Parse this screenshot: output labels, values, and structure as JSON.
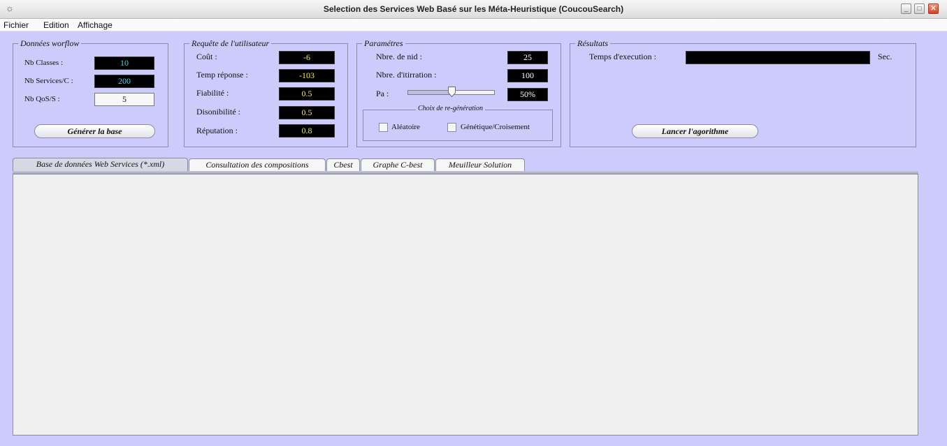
{
  "window": {
    "title": "Selection des Services Web Basé sur les Méta-Heuristique (CoucouSearch)"
  },
  "menu": [
    "Fichier",
    "Edition",
    "Affichage"
  ],
  "workflow": {
    "legend": "Données worflow",
    "nb_classes_label": "Nb Classes :",
    "nb_classes_value": "10",
    "nb_services_label": "Nb Services/C :",
    "nb_services_value": "200",
    "nb_qos_label": "Nb QoS/S :",
    "nb_qos_value": "5",
    "generate_button": "Générer la base"
  },
  "request": {
    "legend": "Requête de l'utilisateur",
    "cout_label": "Coût :",
    "cout_value": "-6",
    "temps_label": "Temp réponse :",
    "temps_value": "-103",
    "fiabilite_label": "Fiabilité :",
    "fiabilite_value": "0.5",
    "disponibilite_label": "Disonibilité :",
    "disponibilite_value": "0.5",
    "reputation_label": "Réputation :",
    "reputation_value": "0.8"
  },
  "params": {
    "legend": "Paramétres",
    "nid_label": "Nbre. de nid :",
    "nid_value": "25",
    "iter_label": "Nbre. d'itirration :",
    "iter_value": "100",
    "pa_label": "Pa :",
    "pa_value": "50%",
    "pa_fraction": 0.5,
    "regen_legend": "Choix de re-génération",
    "aleatoire_label": "Aléatoire",
    "genetique_label": "Génétique/Croisement"
  },
  "results": {
    "legend": "Résultats",
    "exec_label": "Temps d'execution :",
    "exec_value": "",
    "unit": "Sec.",
    "launch_button": "Lancer l'agorithme"
  },
  "tabs": [
    "Base de données Web Services (*.xml)",
    "Consultation des compositions",
    "Cbest",
    "Graphe  C-best",
    "Meuilleur Solution"
  ],
  "colors": {
    "background": "#cccbfc",
    "field_bg": "#000000",
    "cyan_text": "#46d5ee",
    "yellow_text": "#f7e94a"
  }
}
